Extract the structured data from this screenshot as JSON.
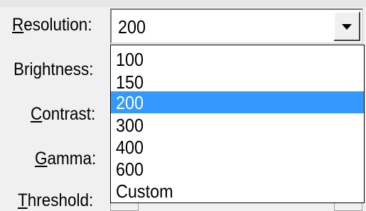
{
  "form": {
    "resolution_label_accel": "R",
    "resolution_label_rest": "esolution:",
    "brightness_label": "Brightness:",
    "contrast_label_accel": "C",
    "contrast_label_rest": "ontrast:",
    "gamma_label_accel": "G",
    "gamma_label_rest": "amma:",
    "threshold_label_accel": "T",
    "threshold_label_rest": "hreshold:"
  },
  "resolution_combo": {
    "value": "200",
    "icon": "chevron-down-icon",
    "options": [
      "100",
      "150",
      "200",
      "300",
      "400",
      "600",
      "Custom"
    ],
    "selected_index": 2
  },
  "colors": {
    "selection": "#3399ff",
    "selection_text": "#ffffff",
    "dialog_bg": "#f0f0f0"
  }
}
